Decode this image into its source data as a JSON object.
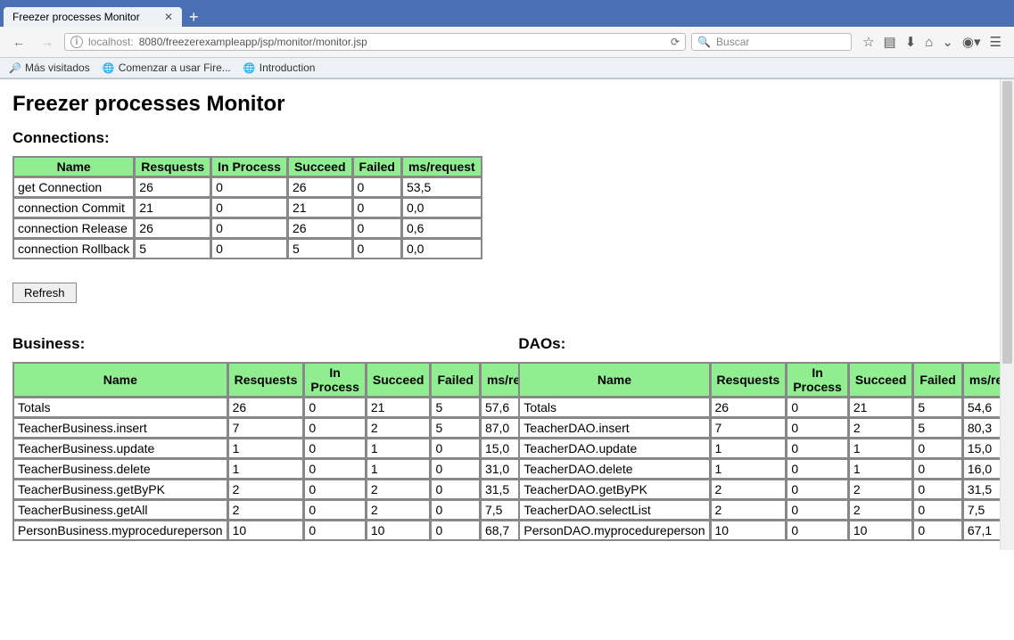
{
  "browser": {
    "tab_title": "Freezer processes Monitor",
    "url_host": "localhost:",
    "url_port_path": "8080/freezerexampleapp/jsp/monitor/monitor.jsp",
    "search_placeholder": "Buscar",
    "bookmarks": [
      "Más visitados",
      "Comenzar a usar Fire...",
      "Introduction"
    ]
  },
  "page_title": "Freezer processes Monitor",
  "connections_heading": "Connections:",
  "business_heading": "Business:",
  "daos_heading": "DAOs:",
  "refresh_label": "Refresh",
  "columns": [
    "Name",
    "Resquests",
    "In Process",
    "Succeed",
    "Failed",
    "ms/request"
  ],
  "connections": [
    {
      "name": "get Connection",
      "req": "26",
      "inproc": "0",
      "succ": "26",
      "fail": "0",
      "ms": "53,5"
    },
    {
      "name": "connection Commit",
      "req": "21",
      "inproc": "0",
      "succ": "21",
      "fail": "0",
      "ms": "0,0"
    },
    {
      "name": "connection Release",
      "req": "26",
      "inproc": "0",
      "succ": "26",
      "fail": "0",
      "ms": "0,6"
    },
    {
      "name": "connection Rollback",
      "req": "5",
      "inproc": "0",
      "succ": "5",
      "fail": "0",
      "ms": "0,0"
    }
  ],
  "business": [
    {
      "name": "Totals",
      "req": "26",
      "inproc": "0",
      "succ": "21",
      "fail": "5",
      "ms": "57,6"
    },
    {
      "name": "TeacherBusiness.insert",
      "req": "7",
      "inproc": "0",
      "succ": "2",
      "fail": "5",
      "ms": "87,0"
    },
    {
      "name": "TeacherBusiness.update",
      "req": "1",
      "inproc": "0",
      "succ": "1",
      "fail": "0",
      "ms": "15,0"
    },
    {
      "name": "TeacherBusiness.delete",
      "req": "1",
      "inproc": "0",
      "succ": "1",
      "fail": "0",
      "ms": "31,0"
    },
    {
      "name": "TeacherBusiness.getByPK",
      "req": "2",
      "inproc": "0",
      "succ": "2",
      "fail": "0",
      "ms": "31,5"
    },
    {
      "name": "TeacherBusiness.getAll",
      "req": "2",
      "inproc": "0",
      "succ": "2",
      "fail": "0",
      "ms": "7,5"
    },
    {
      "name": "PersonBusiness.myprocedureperson",
      "req": "10",
      "inproc": "0",
      "succ": "10",
      "fail": "0",
      "ms": "68,7"
    }
  ],
  "daos": [
    {
      "name": "Totals",
      "req": "26",
      "inproc": "0",
      "succ": "21",
      "fail": "5",
      "ms": "54,6"
    },
    {
      "name": "TeacherDAO.insert",
      "req": "7",
      "inproc": "0",
      "succ": "2",
      "fail": "5",
      "ms": "80,3"
    },
    {
      "name": "TeacherDAO.update",
      "req": "1",
      "inproc": "0",
      "succ": "1",
      "fail": "0",
      "ms": "15,0"
    },
    {
      "name": "TeacherDAO.delete",
      "req": "1",
      "inproc": "0",
      "succ": "1",
      "fail": "0",
      "ms": "16,0"
    },
    {
      "name": "TeacherDAO.getByPK",
      "req": "2",
      "inproc": "0",
      "succ": "2",
      "fail": "0",
      "ms": "31,5"
    },
    {
      "name": "TeacherDAO.selectList",
      "req": "2",
      "inproc": "0",
      "succ": "2",
      "fail": "0",
      "ms": "7,5"
    },
    {
      "name": "PersonDAO.myprocedureperson",
      "req": "10",
      "inproc": "0",
      "succ": "10",
      "fail": "0",
      "ms": "67,1"
    }
  ]
}
